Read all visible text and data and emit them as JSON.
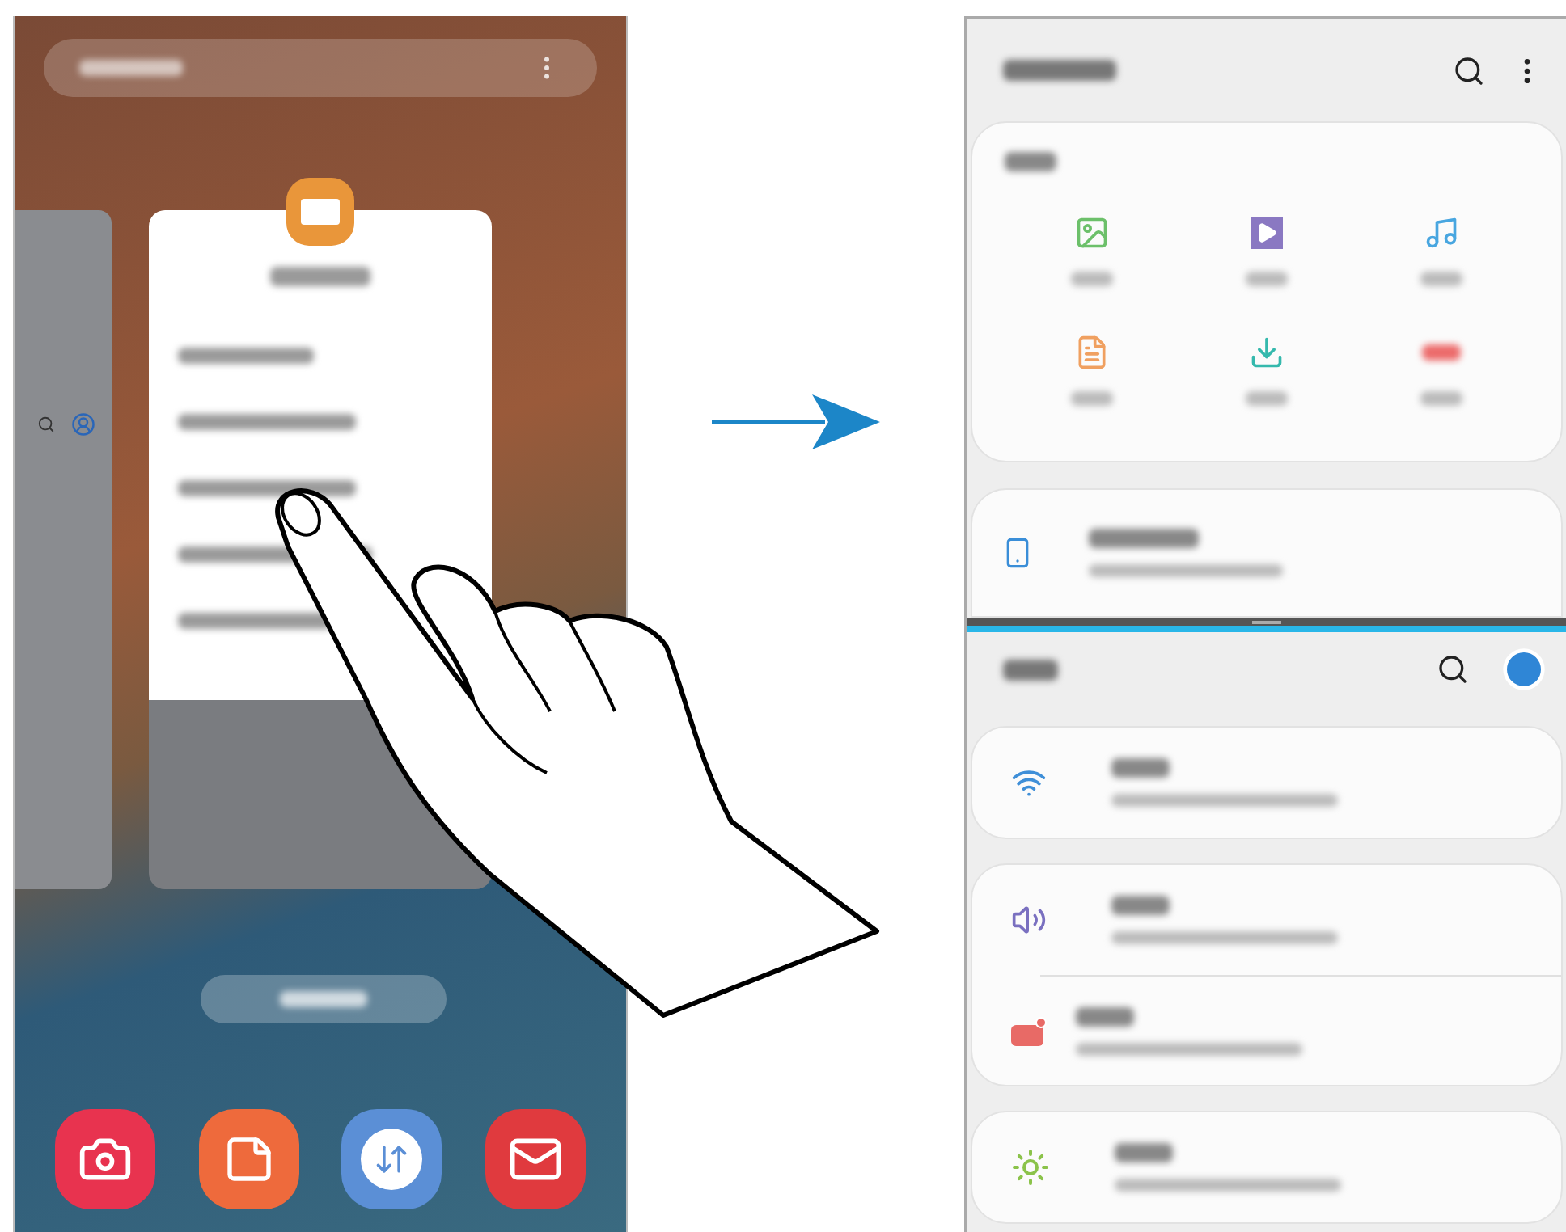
{
  "dock": [
    {
      "kind": "camera"
    },
    {
      "kind": "notes"
    },
    {
      "kind": "transfer"
    },
    {
      "kind": "email"
    }
  ],
  "files": {
    "categories": [
      {
        "kind": "images"
      },
      {
        "kind": "videos"
      },
      {
        "kind": "audio"
      },
      {
        "kind": "documents"
      },
      {
        "kind": "downloads"
      },
      {
        "kind": "apk"
      }
    ]
  },
  "settings": {
    "groups": [
      {
        "items": [
          {
            "kind": "wifi"
          }
        ]
      },
      {
        "items": [
          {
            "kind": "sound"
          },
          {
            "kind": "notifications"
          }
        ]
      },
      {
        "items": [
          {
            "kind": "display"
          }
        ]
      }
    ]
  }
}
